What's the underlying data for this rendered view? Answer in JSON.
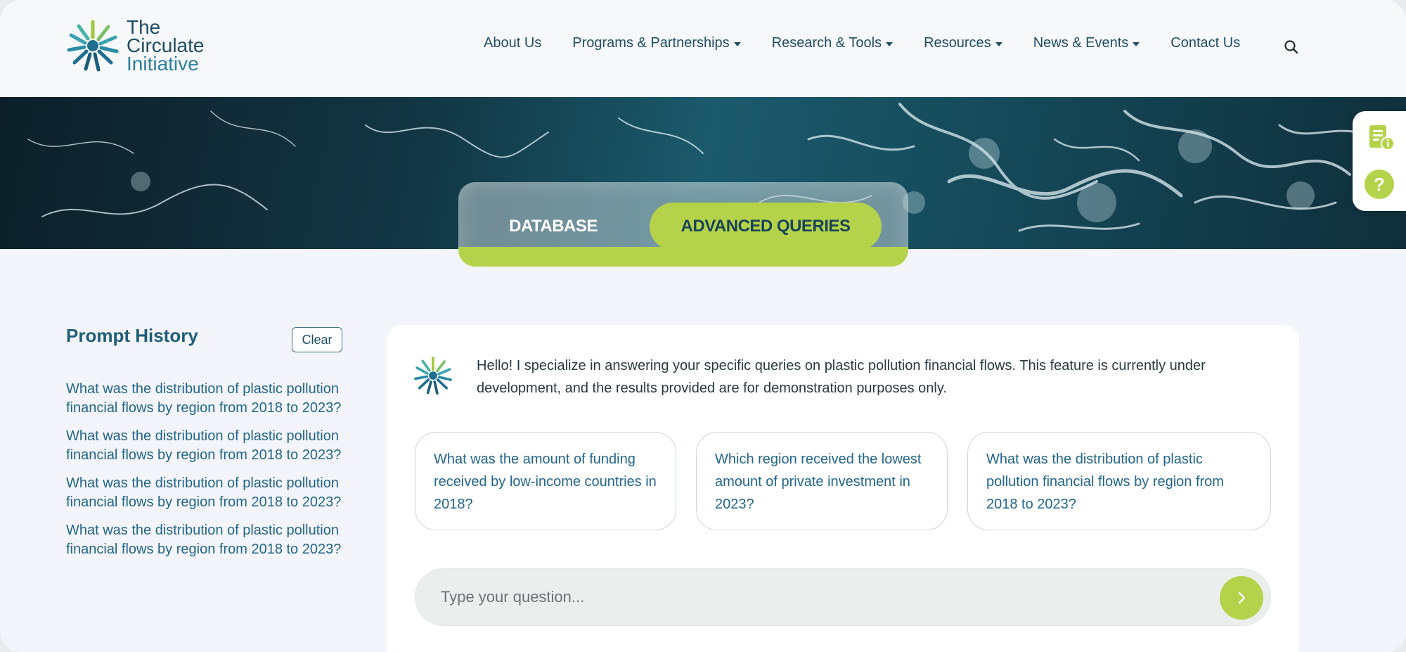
{
  "logo": {
    "line1": "The",
    "line2": "Circulate",
    "line3": "Initiative",
    "icon": "circulate-logo-icon"
  },
  "nav": {
    "items": [
      {
        "label": "About Us",
        "dropdown": false
      },
      {
        "label": "Programs & Partnerships",
        "dropdown": true
      },
      {
        "label": "Research & Tools",
        "dropdown": true
      },
      {
        "label": "Resources",
        "dropdown": true
      },
      {
        "label": "News & Events",
        "dropdown": true
      },
      {
        "label": "Contact Us",
        "dropdown": false
      }
    ],
    "search_icon": "search-icon"
  },
  "tabs": {
    "database": "DATABASE",
    "advanced": "ADVANCED QUERIES",
    "active": "advanced"
  },
  "sidebar": {
    "title": "Prompt History",
    "clear_label": "Clear",
    "history": [
      "What was the distribution of plastic pollution financial flows by region from 2018 to 2023?",
      "What was the distribution of plastic pollution financial flows by region from 2018 to 2023?",
      "What was the distribution of plastic pollution financial flows by region from 2018 to 2023?",
      "What was the distribution of plastic pollution financial flows by region from 2018 to 2023?"
    ]
  },
  "chat": {
    "greeting": "Hello! I specialize in answering your specific queries on plastic pollution financial flows. This feature is currently under development, and the results provided are for demonstration purposes only.",
    "suggestions": [
      "What was the amount of funding received by low-income countries in 2018?",
      "Which region received the lowest amount of private investment in 2023?",
      "What was the distribution of plastic pollution financial flows by region from 2018 to 2023?"
    ],
    "input_placeholder": "Type your question..."
  },
  "colors": {
    "accent": "#b5d34a",
    "primary": "#1f4d63",
    "link": "#22658a"
  }
}
